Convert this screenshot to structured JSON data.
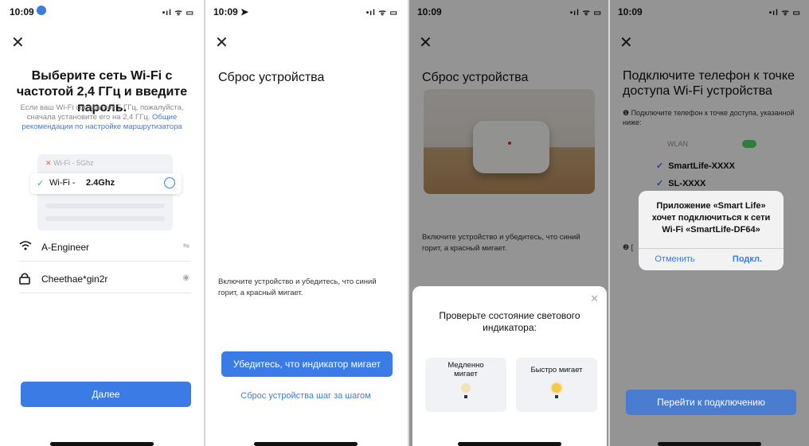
{
  "colors": {
    "accent": "#3b7be6",
    "toggle": "#4cd964",
    "bulb_on": "#f7c948",
    "bulb_off": "#f1e3b5",
    "led_red": "#d9302b"
  },
  "screen1": {
    "time": "10:09",
    "status_icons": "•ıl ᯤ ▭",
    "close": "✕",
    "title": "Выберите сеть Wi-Fi с частотой 2,4 ГГц и введите пароль.",
    "subtitle_prefix": "Если ваш Wi-Fi составляет 5 ГГц, пожалуйста, сначала установите его на 2,4 ГГц.",
    "subtitle_link": "Общие рекомендации по настройке маршрутизатора",
    "wifi5_mark": "✕",
    "wifi5_label": "Wi-Fi - 5Ghz",
    "wifi24_check": "✓",
    "wifi24_prefix": "Wi-Fi -",
    "wifi24_bold": "2.4Ghz",
    "network_icon": "wifi-icon",
    "network_name": "A-Engineer",
    "network_switch": "⇋",
    "password_icon": "lock-icon",
    "password_value": "Cheethae*gin2r",
    "eye": "◉",
    "next_button": "Далее"
  },
  "screen2": {
    "time": "10:09 ➤",
    "status_icons": "•ıl ᯤ ▭",
    "close": "✕",
    "title": "Сброс устройства",
    "instruction": "Включите устройство и убедитесь, что синий горит, а красный мигает.",
    "confirm_button": "Убедитесь, что индикатор мигает",
    "step_link": "Сброс устройства шаг за шагом"
  },
  "screen3": {
    "time": "10:09",
    "status_icons": "•ıl ᯤ ▭",
    "close": "✕",
    "title": "Сброс устройства",
    "instruction": "Включите устройство и убедитесь, что синий горит, а красный мигает.",
    "sheet_close": "✕",
    "sheet_title": "Проверьте состояние светового индикатора:",
    "slow_label": "Медленно мигает",
    "fast_label": "Быстро мигает"
  },
  "screen4": {
    "time": "10:09",
    "status_icons": "•ıl ᯤ ▭",
    "close": "✕",
    "title": "Подключите телефон к точке доступа Wi-Fi устройства",
    "step1": "❶ Подключите телефон к точке доступа, указанной ниже:",
    "wlan_label": "WLAN",
    "ssid1": "SmartLife-XXXX",
    "ssid2": "SL-XXXX",
    "check": "✓",
    "step2_partial": "❷ [",
    "alert_text": "Приложение «Smart Life» хочет подключиться к сети Wi-Fi «SmartLife-DF64»",
    "alert_cancel": "Отменить",
    "alert_connect": "Подкл.",
    "go_button": "Перейти к подключению"
  }
}
